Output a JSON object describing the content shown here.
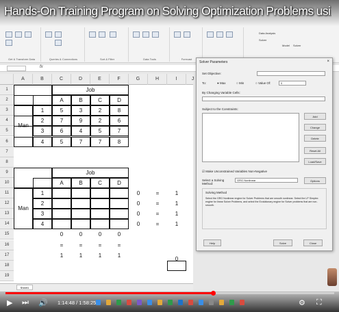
{
  "video": {
    "title": "Hands-On Training Program on Solving Optimization Problems using Microsoft Excel and Solver - Day...",
    "time": "1:14:48 / 1:58:25",
    "progress": 0.632
  },
  "ribbon": {
    "groups": [
      "Get & Transform Data",
      "Queries & Connections",
      "Sort & Filter",
      "Data Tools",
      "Forecast",
      "Outline"
    ],
    "right_items": [
      "Data Analysis",
      "Solver",
      "Model",
      "Solver"
    ]
  },
  "formula_bar": {
    "fx": "fx"
  },
  "sheet": {
    "columns": [
      "A",
      "B",
      "C",
      "D",
      "E",
      "F",
      "G",
      "H",
      "I",
      "J"
    ],
    "rows": [
      "1",
      "2",
      "3",
      "4",
      "5",
      "6",
      "7",
      "8",
      "9",
      "10",
      "11",
      "12",
      "13",
      "14",
      "15",
      "16",
      "17",
      "18",
      "19"
    ],
    "table1": {
      "title": "Job",
      "headers": [
        "A",
        "B",
        "C",
        "D"
      ],
      "row_label": "Man",
      "men": [
        "1",
        "2",
        "3",
        "4"
      ],
      "values": [
        [
          "5",
          "3",
          "2",
          "8"
        ],
        [
          "7",
          "9",
          "2",
          "6"
        ],
        [
          "6",
          "4",
          "5",
          "7"
        ],
        [
          "5",
          "7",
          "7",
          "8"
        ]
      ]
    },
    "table2": {
      "title": "Job",
      "headers": [
        "A",
        "B",
        "C",
        "D"
      ],
      "row_label": "Man",
      "men": [
        "1",
        "2",
        "3",
        "4"
      ],
      "g_vals": [
        "0",
        "0",
        "0",
        "0"
      ],
      "h_vals": [
        "=",
        "=",
        "=",
        "="
      ],
      "i_vals": [
        "1",
        "1",
        "1",
        "1"
      ],
      "r15": [
        "0",
        "0",
        "0",
        "0"
      ],
      "r16": [
        "=",
        "=",
        "=",
        "="
      ],
      "r17": [
        "1",
        "1",
        "1",
        "1"
      ],
      "obj": "0"
    },
    "tab": "Sheet1"
  },
  "dialog": {
    "title": "Solver Parameters",
    "set_objective": "Set Objective:",
    "to": "To:",
    "max": "Max",
    "min": "Min",
    "value_of": "Value Of:",
    "value": "0",
    "by_changing": "By Changing Variable Cells:",
    "subject_to": "Subject to the Constraints:",
    "buttons": [
      "Add",
      "Change",
      "Delete",
      "Reset All",
      "Load/Save"
    ],
    "nonneg": "Make Unconstrained Variables Non-Negative",
    "method_label": "Select a Solving Method:",
    "method": "GRG Nonlinear",
    "options": "Options",
    "solving_method": "Solving Method",
    "desc": "Select the GRG Nonlinear engine for Solver Problems that are smooth nonlinear. Select the LP Simplex engine for linear Solver Problems, and select the Evolutionary engine for Solver problems that are non-smooth.",
    "help": "Help",
    "solve": "Solve",
    "close": "Close"
  }
}
